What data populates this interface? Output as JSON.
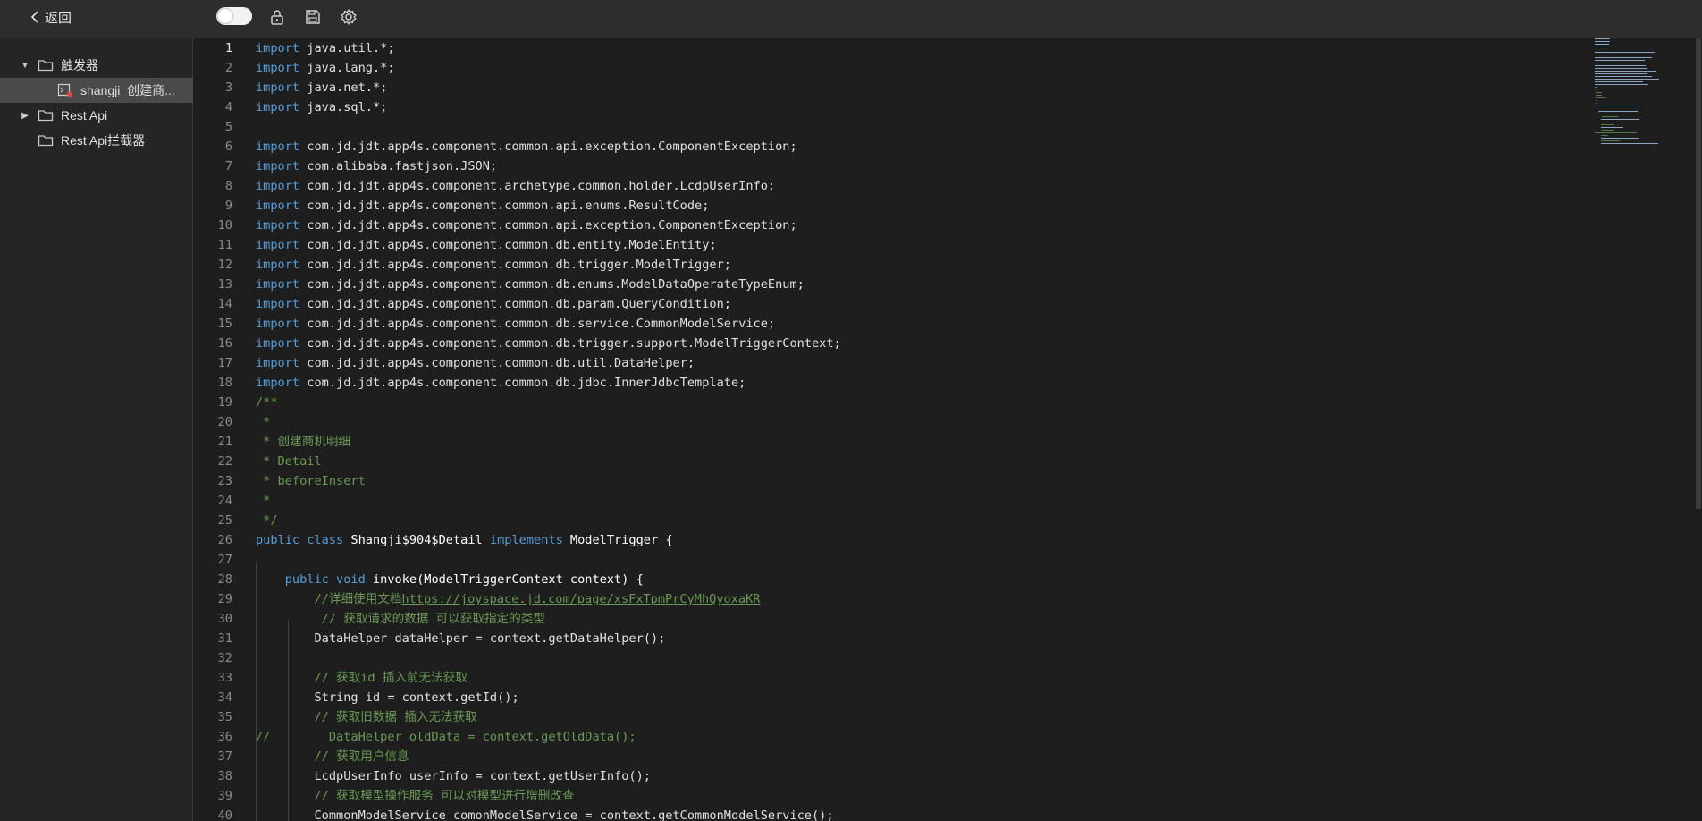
{
  "header": {
    "back_label": "返回",
    "toggle_on": false,
    "icons": [
      "lock-icon",
      "save-icon",
      "gear-icon"
    ]
  },
  "sidebar": {
    "items": [
      {
        "label": "触发器",
        "expanded": true,
        "icon": "folder-icon"
      },
      {
        "label": "shangji_创建商...",
        "selected": true,
        "icon": "script-file-icon"
      },
      {
        "label": "Rest Api",
        "expanded": false,
        "icon": "folder-icon"
      },
      {
        "label": "Rest Api拦截器",
        "icon": "folder-icon"
      }
    ]
  },
  "editor": {
    "active_line": 1,
    "lines": [
      {
        "n": "1",
        "parts": [
          [
            "kw",
            "import"
          ],
          [
            "t",
            " java.util.*;"
          ]
        ]
      },
      {
        "n": "2",
        "parts": [
          [
            "kw",
            "import"
          ],
          [
            "t",
            " java.lang.*;"
          ]
        ]
      },
      {
        "n": "3",
        "parts": [
          [
            "kw",
            "import"
          ],
          [
            "t",
            " java.net.*;"
          ]
        ]
      },
      {
        "n": "4",
        "parts": [
          [
            "kw",
            "import"
          ],
          [
            "t",
            " java.sql.*;"
          ]
        ]
      },
      {
        "n": "5",
        "parts": []
      },
      {
        "n": "6",
        "parts": [
          [
            "kw",
            "import"
          ],
          [
            "t",
            " com.jd.jdt.app4s.component.common.api.exception.ComponentException;"
          ]
        ]
      },
      {
        "n": "7",
        "parts": [
          [
            "kw",
            "import"
          ],
          [
            "t",
            " com.alibaba.fastjson.JSON;"
          ]
        ]
      },
      {
        "n": "8",
        "parts": [
          [
            "kw",
            "import"
          ],
          [
            "t",
            " com.jd.jdt.app4s.component.archetype.common.holder.LcdpUserInfo;"
          ]
        ]
      },
      {
        "n": "9",
        "parts": [
          [
            "kw",
            "import"
          ],
          [
            "t",
            " com.jd.jdt.app4s.component.common.api.enums.ResultCode;"
          ]
        ]
      },
      {
        "n": "10",
        "parts": [
          [
            "kw",
            "import"
          ],
          [
            "t",
            " com.jd.jdt.app4s.component.common.api.exception.ComponentException;"
          ]
        ]
      },
      {
        "n": "11",
        "parts": [
          [
            "kw",
            "import"
          ],
          [
            "t",
            " com.jd.jdt.app4s.component.common.db.entity.ModelEntity;"
          ]
        ]
      },
      {
        "n": "12",
        "parts": [
          [
            "kw",
            "import"
          ],
          [
            "t",
            " com.jd.jdt.app4s.component.common.db.trigger.ModelTrigger;"
          ]
        ]
      },
      {
        "n": "13",
        "parts": [
          [
            "kw",
            "import"
          ],
          [
            "t",
            " com.jd.jdt.app4s.component.common.db.enums.ModelDataOperateTypeEnum;"
          ]
        ]
      },
      {
        "n": "14",
        "parts": [
          [
            "kw",
            "import"
          ],
          [
            "t",
            " com.jd.jdt.app4s.component.common.db.param.QueryCondition;"
          ]
        ]
      },
      {
        "n": "15",
        "parts": [
          [
            "kw",
            "import"
          ],
          [
            "t",
            " com.jd.jdt.app4s.component.common.db.service.CommonModelService;"
          ]
        ]
      },
      {
        "n": "16",
        "parts": [
          [
            "kw",
            "import"
          ],
          [
            "t",
            " com.jd.jdt.app4s.component.common.db.trigger.support.ModelTriggerContext;"
          ]
        ]
      },
      {
        "n": "17",
        "parts": [
          [
            "kw",
            "import"
          ],
          [
            "t",
            " com.jd.jdt.app4s.component.common.db.util.DataHelper;"
          ]
        ]
      },
      {
        "n": "18",
        "parts": [
          [
            "kw",
            "import"
          ],
          [
            "t",
            " com.jd.jdt.app4s.component.common.db.jdbc.InnerJdbcTemplate;"
          ]
        ]
      },
      {
        "n": "19",
        "parts": [
          [
            "cm",
            "/**"
          ]
        ]
      },
      {
        "n": "20",
        "parts": [
          [
            "cm",
            " *"
          ]
        ]
      },
      {
        "n": "21",
        "parts": [
          [
            "cm",
            " * 创建商机明细"
          ]
        ]
      },
      {
        "n": "22",
        "parts": [
          [
            "cm",
            " * Detail"
          ]
        ]
      },
      {
        "n": "23",
        "parts": [
          [
            "cm",
            " * beforeInsert"
          ]
        ]
      },
      {
        "n": "24",
        "parts": [
          [
            "cm",
            " *"
          ]
        ]
      },
      {
        "n": "25",
        "parts": [
          [
            "cm",
            " */"
          ]
        ]
      },
      {
        "n": "26",
        "parts": [
          [
            "kw",
            "public class"
          ],
          [
            "cls",
            " Shangji$904$Detail "
          ],
          [
            "kw",
            "implements"
          ],
          [
            "cls",
            " ModelTrigger {"
          ]
        ]
      },
      {
        "n": "27",
        "parts": []
      },
      {
        "n": "28",
        "parts": [
          [
            "t",
            "    "
          ],
          [
            "kw",
            "public void"
          ],
          [
            "cls",
            " invoke(ModelTriggerContext context) {"
          ]
        ]
      },
      {
        "n": "29",
        "parts": [
          [
            "t",
            "        "
          ],
          [
            "cm",
            "//详细使用文档"
          ],
          [
            "cm-url",
            "https://joyspace.jd.com/page/xsFxTpmPrCyMhQyoxaKR"
          ]
        ]
      },
      {
        "n": "30",
        "parts": [
          [
            "t",
            "         "
          ],
          [
            "cm",
            "// 获取请求的数据 可以获取指定的类型"
          ]
        ]
      },
      {
        "n": "31",
        "parts": [
          [
            "t",
            "        DataHelper dataHelper = context.getDataHelper();"
          ]
        ]
      },
      {
        "n": "32",
        "parts": []
      },
      {
        "n": "33",
        "parts": [
          [
            "t",
            "        "
          ],
          [
            "cm",
            "// 获取id 插入前无法获取"
          ]
        ]
      },
      {
        "n": "34",
        "parts": [
          [
            "t",
            "        String id = context.getId();"
          ]
        ]
      },
      {
        "n": "35",
        "parts": [
          [
            "t",
            "        "
          ],
          [
            "cm",
            "// 获取旧数据 插入无法获取"
          ]
        ]
      },
      {
        "n": "36",
        "parts": [
          [
            "cm",
            "//        DataHelper oldData = context.getOldData();"
          ]
        ]
      },
      {
        "n": "37",
        "parts": [
          [
            "t",
            "        "
          ],
          [
            "cm",
            "// 获取用户信息"
          ]
        ]
      },
      {
        "n": "38",
        "parts": [
          [
            "t",
            "        LcdpUserInfo userInfo = context.getUserInfo();"
          ]
        ]
      },
      {
        "n": "39",
        "parts": [
          [
            "t",
            "        "
          ],
          [
            "cm",
            "// 获取模型操作服务 可以对模型进行增删改查"
          ]
        ]
      },
      {
        "n": "40",
        "parts": [
          [
            "t",
            "        CommonModelService comonModelService = context.getCommonModelService();"
          ]
        ]
      }
    ]
  }
}
